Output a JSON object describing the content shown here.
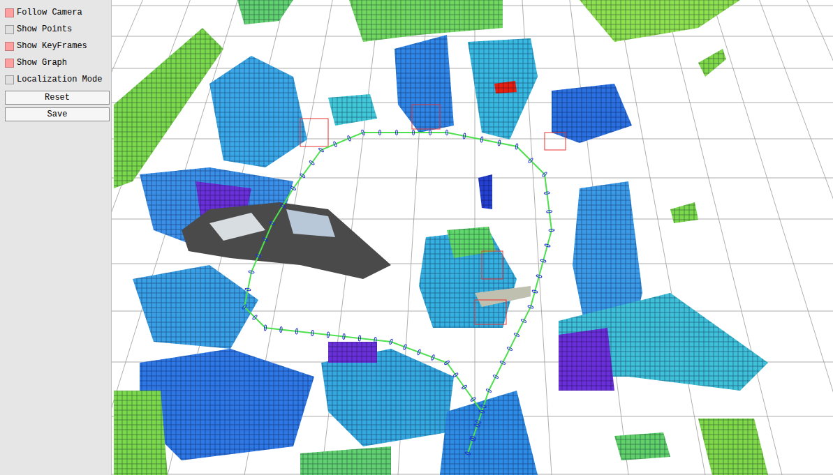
{
  "panel": {
    "items": [
      {
        "label": "Follow Camera",
        "checked": true
      },
      {
        "label": "Show Points",
        "checked": false
      },
      {
        "label": "Show KeyFrames",
        "checked": true
      },
      {
        "label": "Show Graph",
        "checked": true
      },
      {
        "label": "Localization Mode",
        "checked": false
      }
    ],
    "buttons": [
      "Reset",
      "Save"
    ]
  }
}
